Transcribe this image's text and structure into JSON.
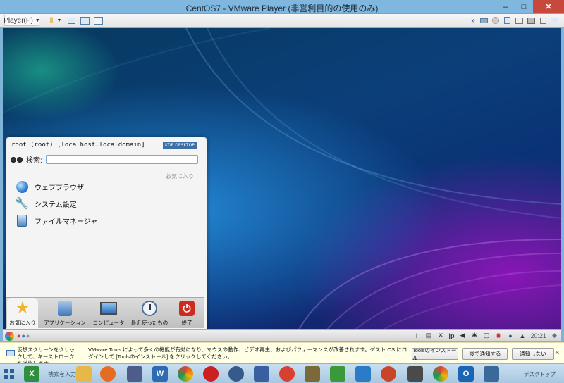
{
  "window": {
    "title": "CentOS7 - VMware Player (非営利目的の使用のみ)",
    "controls": {
      "minimize": "–",
      "maximize": "□",
      "close": "✕"
    }
  },
  "toolbar": {
    "player_label": "Player(P)"
  },
  "kde_menu": {
    "user_header": "root (root) [localhost.localdomain]",
    "badge": "KDE DESKTOP",
    "search_label": "検索:",
    "search_value": "",
    "favorites_header": "お気に入り",
    "items": [
      {
        "label": "ウェブブラウザ",
        "icon": "globe-icon"
      },
      {
        "label": "システム設定",
        "icon": "tools-icon"
      },
      {
        "label": "ファイルマネージャ",
        "icon": "file-manager-icon"
      }
    ],
    "tabs": [
      {
        "label": "お気に入り",
        "icon": "star-icon",
        "active": true
      },
      {
        "label": "アプリケーション",
        "icon": "applications-icon"
      },
      {
        "label": "コンピュータ",
        "icon": "computer-icon"
      },
      {
        "label": "最近使ったもの",
        "icon": "recent-clock-icon"
      },
      {
        "label": "終了",
        "icon": "power-icon"
      }
    ]
  },
  "panel": {
    "tray_lang": "jp",
    "tray_info": "i",
    "clock": "20:21"
  },
  "hint_bar": {
    "left_text": "仮想スクリーンをクリックして、キーストロークを送信します",
    "main_text": "VMware Tools によって多くの機能が有効になり、マウスの動作、ビデオ再生、およびパフォーマンスが改善されます。ゲスト OS にログインして [Toolsのインストール] をクリックしてください。",
    "install_button": "Toolsのインストール",
    "remind_button": "後で通知する",
    "never_button": "通知しない",
    "close": "✕"
  },
  "taskbar": {
    "search_text": "検索を入力して",
    "desktop_label": "デスクトップ"
  },
  "colors": {
    "titlebar": "#7fb7de",
    "close": "#c9483c",
    "hint_bg": "#ffffe6",
    "taskbar": "#b8d3e8"
  }
}
